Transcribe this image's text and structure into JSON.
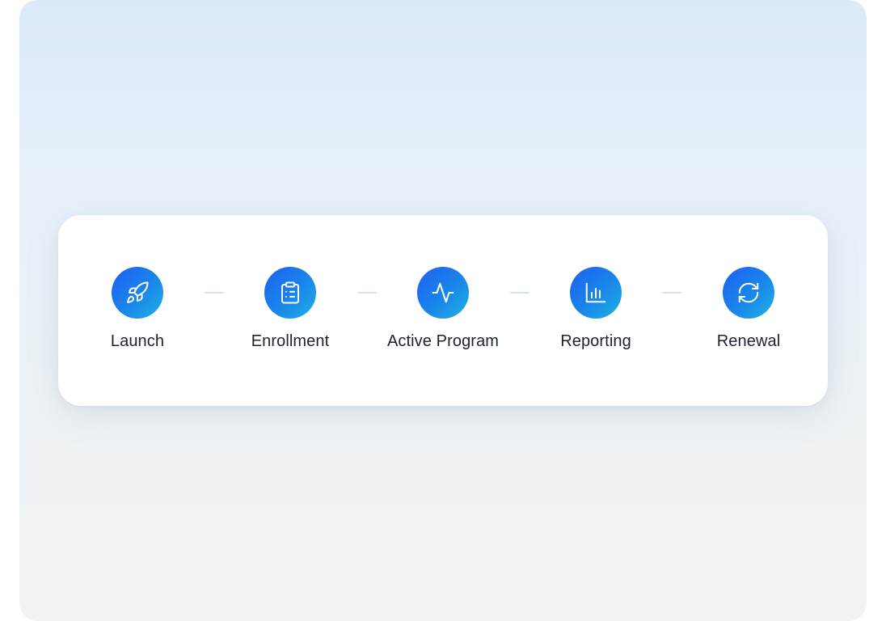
{
  "theme": {
    "accent_start": "#1d5ff2",
    "accent_end": "#1fb3e0",
    "connector_color": "#cfe4f5",
    "label_color": "#1a2233"
  },
  "steps": [
    {
      "label": "Launch",
      "icon": "rocket-icon"
    },
    {
      "label": "Enrollment",
      "icon": "clipboard-list-icon"
    },
    {
      "label": "Active Program",
      "icon": "activity-pulse-icon"
    },
    {
      "label": "Reporting",
      "icon": "bar-chart-icon"
    },
    {
      "label": "Renewal",
      "icon": "refresh-icon"
    }
  ]
}
